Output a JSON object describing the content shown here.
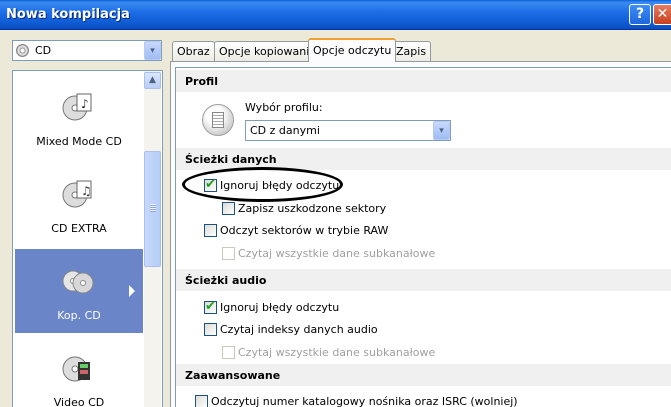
{
  "window": {
    "title": "Nowa kompilacja",
    "help_glyph": "?",
    "close_glyph": "✕"
  },
  "left": {
    "drive_combo": {
      "value": "CD",
      "arrow": "▾"
    },
    "scroll_up_glyph": "▲",
    "items": [
      {
        "label": "Mixed Mode CD",
        "icon": "mixed-mode-cd-icon",
        "selected": false
      },
      {
        "label": "CD EXTRA",
        "icon": "cd-extra-icon",
        "selected": false
      },
      {
        "label": "Kop. CD",
        "icon": "copy-cd-icon",
        "selected": true
      },
      {
        "label": "Video CD",
        "icon": "video-cd-icon",
        "selected": false
      }
    ]
  },
  "tabs": [
    {
      "label": "Obraz",
      "active": false
    },
    {
      "label": "Opcje kopiowania",
      "active": false
    },
    {
      "label": "Opcje odczytu",
      "active": true
    },
    {
      "label": "Zapis",
      "active": false
    }
  ],
  "profile": {
    "heading": "Profil",
    "label": "Wybór profilu:",
    "selected": "CD z danymi",
    "arrow": "▾"
  },
  "data_tracks": {
    "heading": "Ścieżki danych",
    "ignore_errors": {
      "label": "Ignoruj błędy odczytu",
      "checked": true,
      "enabled": true
    },
    "save_damaged": {
      "label": "Zapisz uszkodzone sektory",
      "checked": false,
      "enabled": true
    },
    "raw_read": {
      "label": "Odczyt sektorów w trybie RAW",
      "checked": false,
      "enabled": true
    },
    "read_subchannel": {
      "label": "Czytaj wszystkie dane subkanałowe",
      "checked": false,
      "enabled": false
    }
  },
  "audio_tracks": {
    "heading": "Ścieżki audio",
    "ignore_errors": {
      "label": "Ignoruj błędy odczytu",
      "checked": true,
      "enabled": true
    },
    "read_indexes": {
      "label": "Czytaj indeksy danych audio",
      "checked": false,
      "enabled": true
    },
    "read_subchannel": {
      "label": "Czytaj wszystkie dane subkanałowe",
      "checked": false,
      "enabled": false
    }
  },
  "advanced": {
    "heading": "Zaawansowane",
    "read_isrc": {
      "label": "Odczytuj numer katalogowy nośnika oraz ISRC (wolniej)",
      "checked": false,
      "enabled": true
    }
  },
  "check_glyph": "✔",
  "colors": {
    "titlebar": "#1e6fe8",
    "selected_item": "#6a85c8",
    "active_tab_accent": "#f0a030",
    "checkmark": "#21a121"
  }
}
